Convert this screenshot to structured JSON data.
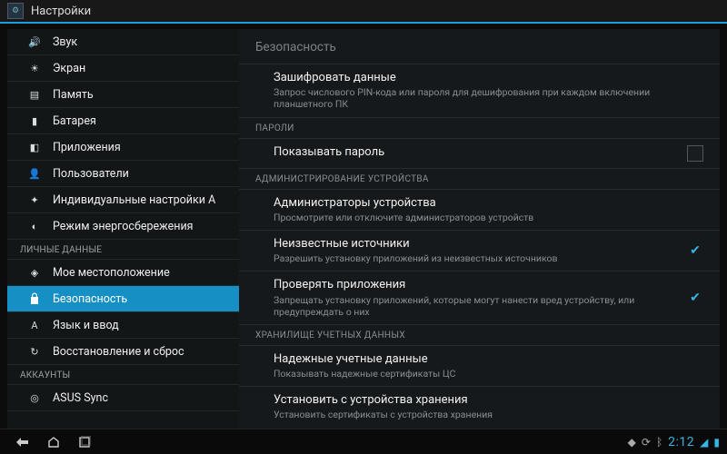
{
  "header": {
    "title": "Настройки"
  },
  "sidebar": {
    "items": [
      {
        "icon": "sound-icon",
        "label": "Звук"
      },
      {
        "icon": "display-icon",
        "label": "Экран"
      },
      {
        "icon": "memory-icon",
        "label": "Память"
      },
      {
        "icon": "battery-icon",
        "label": "Батарея"
      },
      {
        "icon": "apps-icon",
        "label": "Приложения"
      },
      {
        "icon": "users-icon",
        "label": "Пользователи"
      },
      {
        "icon": "custom-icon",
        "label": "Индивидуальные настройки A"
      },
      {
        "icon": "powersave-icon",
        "label": "Режим энергосбережения"
      }
    ],
    "section_personal": "ЛИЧНЫЕ ДАННЫЕ",
    "personal_items": [
      {
        "icon": "location-icon",
        "label": "Мое местоположение"
      },
      {
        "icon": "lock-icon",
        "label": "Безопасность",
        "selected": true
      },
      {
        "icon": "language-icon",
        "label": "Язык и ввод"
      },
      {
        "icon": "backup-icon",
        "label": "Восстановление и сброс"
      }
    ],
    "section_accounts": "АККАУНТЫ",
    "account_items": [
      {
        "icon": "asus-icon",
        "label": "ASUS Sync"
      }
    ]
  },
  "main": {
    "title": "Безопасность",
    "encrypt": {
      "label": "Зашифровать данные",
      "sub": "Запрос числового PIN-кода или пароля для дешифрования при каждом включении планшетного ПК"
    },
    "sec_passwords": "ПАРОЛИ",
    "show_password": {
      "label": "Показывать пароль"
    },
    "sec_admin": "АДМИНИСТРИРОВАНИЕ УСТРОЙСТВА",
    "device_admins": {
      "label": "Администраторы устройства",
      "sub": "Просмотрите или отключите администраторов устройств"
    },
    "unknown_sources": {
      "label": "Неизвестные источники",
      "sub": "Разрешить установку приложений из неизвестных источников"
    },
    "verify_apps": {
      "label": "Проверять приложения",
      "sub": "Запрещать установку приложений, которые могут нанести вред устройству, или предупреждать о них"
    },
    "sec_credstore": "ХРАНИЛИЩЕ УЧЕТНЫХ ДАННЫХ",
    "trusted_creds": {
      "label": "Надежные учетные данные",
      "sub": "Показывать надежные сертификаты ЦС"
    },
    "install_from_storage": {
      "label": "Установить с устройства хранения",
      "sub": "Установить сертификаты с устройства хранения"
    }
  },
  "navbar": {
    "clock": "2:12"
  },
  "colors": {
    "accent": "#168fc5",
    "holo": "#33b5e5"
  }
}
